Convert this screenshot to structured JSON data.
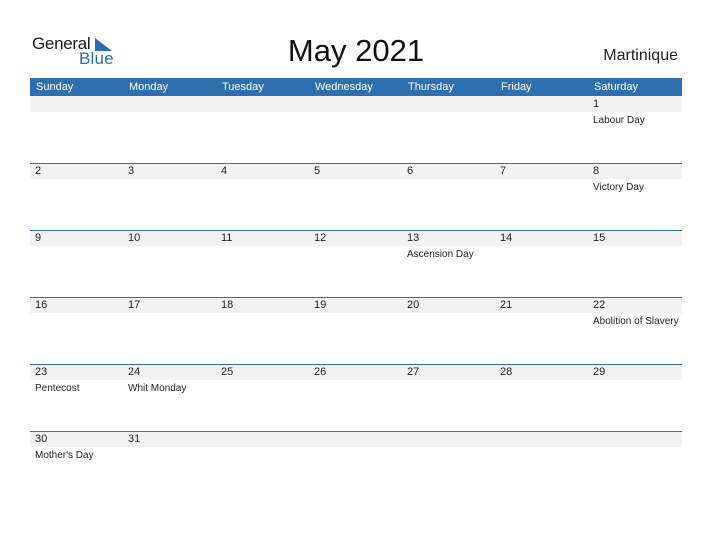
{
  "logo": {
    "part1": "General",
    "part2": "Blue"
  },
  "title": "May 2021",
  "country": "Martinique",
  "weekdays": [
    "Sunday",
    "Monday",
    "Tuesday",
    "Wednesday",
    "Thursday",
    "Friday",
    "Saturday"
  ],
  "weeks": [
    [
      {
        "day": "",
        "event": ""
      },
      {
        "day": "",
        "event": ""
      },
      {
        "day": "",
        "event": ""
      },
      {
        "day": "",
        "event": ""
      },
      {
        "day": "",
        "event": ""
      },
      {
        "day": "",
        "event": ""
      },
      {
        "day": "1",
        "event": "Labour Day"
      }
    ],
    [
      {
        "day": "2",
        "event": ""
      },
      {
        "day": "3",
        "event": ""
      },
      {
        "day": "4",
        "event": ""
      },
      {
        "day": "5",
        "event": ""
      },
      {
        "day": "6",
        "event": ""
      },
      {
        "day": "7",
        "event": ""
      },
      {
        "day": "8",
        "event": "Victory Day"
      }
    ],
    [
      {
        "day": "9",
        "event": ""
      },
      {
        "day": "10",
        "event": ""
      },
      {
        "day": "11",
        "event": ""
      },
      {
        "day": "12",
        "event": ""
      },
      {
        "day": "13",
        "event": "Ascension Day"
      },
      {
        "day": "14",
        "event": ""
      },
      {
        "day": "15",
        "event": ""
      }
    ],
    [
      {
        "day": "16",
        "event": ""
      },
      {
        "day": "17",
        "event": ""
      },
      {
        "day": "18",
        "event": ""
      },
      {
        "day": "19",
        "event": ""
      },
      {
        "day": "20",
        "event": ""
      },
      {
        "day": "21",
        "event": ""
      },
      {
        "day": "22",
        "event": "Abolition of Slavery"
      }
    ],
    [
      {
        "day": "23",
        "event": "Pentecost"
      },
      {
        "day": "24",
        "event": "Whit Monday"
      },
      {
        "day": "25",
        "event": ""
      },
      {
        "day": "26",
        "event": ""
      },
      {
        "day": "27",
        "event": ""
      },
      {
        "day": "28",
        "event": ""
      },
      {
        "day": "29",
        "event": ""
      }
    ],
    [
      {
        "day": "30",
        "event": "Mother's Day"
      },
      {
        "day": "31",
        "event": ""
      },
      {
        "day": "",
        "event": ""
      },
      {
        "day": "",
        "event": ""
      },
      {
        "day": "",
        "event": ""
      },
      {
        "day": "",
        "event": ""
      },
      {
        "day": "",
        "event": ""
      }
    ]
  ],
  "colors": {
    "accent": "#2e6fb0",
    "strip": "#f2f2f2"
  }
}
